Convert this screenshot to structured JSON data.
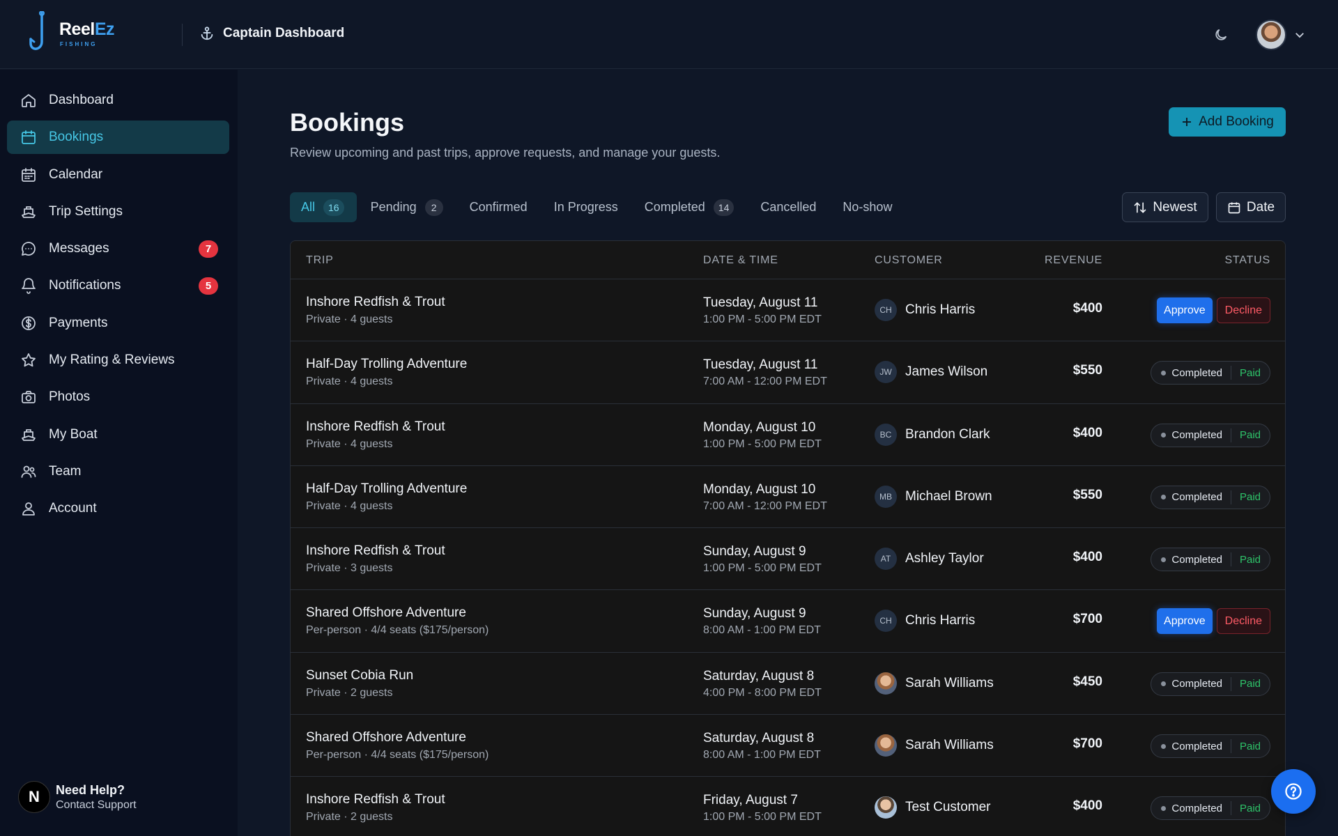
{
  "app": {
    "logo_main": "Reel",
    "logo_accent": "Ez",
    "logo_sub": "FISHING",
    "header_title": "Captain Dashboard"
  },
  "sidebar": {
    "items": [
      {
        "label": "Dashboard",
        "icon": "home-icon"
      },
      {
        "label": "Bookings",
        "icon": "calendar-icon",
        "active": true
      },
      {
        "label": "Calendar",
        "icon": "calendar-grid-icon"
      },
      {
        "label": "Trip Settings",
        "icon": "boat-icon"
      },
      {
        "label": "Messages",
        "icon": "chat-icon",
        "badge": "7"
      },
      {
        "label": "Notifications",
        "icon": "bell-icon",
        "badge": "5"
      },
      {
        "label": "Payments",
        "icon": "dollar-icon"
      },
      {
        "label": "My Rating & Reviews",
        "icon": "star-icon"
      },
      {
        "label": "Photos",
        "icon": "camera-icon"
      },
      {
        "label": "My Boat",
        "icon": "boat-icon"
      },
      {
        "label": "Team",
        "icon": "team-icon"
      },
      {
        "label": "Account",
        "icon": "user-icon"
      }
    ],
    "help_title": "Need Help?",
    "help_sub": "Contact Support",
    "help_avatar": "N"
  },
  "main": {
    "title": "Bookings",
    "subtitle": "Review upcoming and past trips, approve requests, and manage your guests.",
    "add_label": "Add Booking",
    "tabs": [
      {
        "label": "All",
        "count": "16",
        "active": true
      },
      {
        "label": "Pending",
        "count": "2"
      },
      {
        "label": "Confirmed"
      },
      {
        "label": "In Progress"
      },
      {
        "label": "Completed",
        "count": "14"
      },
      {
        "label": "Cancelled"
      },
      {
        "label": "No-show"
      }
    ],
    "sort_label": "Newest",
    "date_label": "Date"
  },
  "table": {
    "headers": {
      "trip": "TRIP",
      "datetime": "DATE & TIME",
      "customer": "CUSTOMER",
      "revenue": "REVENUE",
      "status": "STATUS"
    },
    "approve_label": "Approve",
    "decline_label": "Decline",
    "rows": [
      {
        "trip": "Inshore Redfish & Trout",
        "sub": "Private · 4 guests",
        "date": "Tuesday, August 11",
        "time": "1:00 PM - 5:00 PM EDT",
        "initials": "CH",
        "customer": "Chris Harris",
        "revenue": "$400",
        "status": "pending"
      },
      {
        "trip": "Half-Day Trolling Adventure",
        "sub": "Private · 4 guests",
        "date": "Tuesday, August 11",
        "time": "7:00 AM - 12:00 PM EDT",
        "initials": "JW",
        "customer": "James Wilson",
        "revenue": "$550",
        "status": "Completed",
        "payment": "Paid"
      },
      {
        "trip": "Inshore Redfish & Trout",
        "sub": "Private · 4 guests",
        "date": "Monday, August 10",
        "time": "1:00 PM - 5:00 PM EDT",
        "initials": "BC",
        "customer": "Brandon Clark",
        "revenue": "$400",
        "status": "Completed",
        "payment": "Paid"
      },
      {
        "trip": "Half-Day Trolling Adventure",
        "sub": "Private · 4 guests",
        "date": "Monday, August 10",
        "time": "7:00 AM - 12:00 PM EDT",
        "initials": "MB",
        "customer": "Michael Brown",
        "revenue": "$550",
        "status": "Completed",
        "payment": "Paid"
      },
      {
        "trip": "Inshore Redfish & Trout",
        "sub": "Private · 3 guests",
        "date": "Sunday, August 9",
        "time": "1:00 PM - 5:00 PM EDT",
        "initials": "AT",
        "customer": "Ashley Taylor",
        "revenue": "$400",
        "status": "Completed",
        "payment": "Paid"
      },
      {
        "trip": "Shared Offshore Adventure",
        "sub": "Per-person · 4/4 seats ($175/person)",
        "date": "Sunday, August 9",
        "time": "8:00 AM - 1:00 PM EDT",
        "initials": "CH",
        "customer": "Chris Harris",
        "revenue": "$700",
        "status": "pending"
      },
      {
        "trip": "Sunset Cobia Run",
        "sub": "Private · 2 guests",
        "date": "Saturday, August 8",
        "time": "4:00 PM - 8:00 PM EDT",
        "initials": "",
        "photo": "photo",
        "customer": "Sarah Williams",
        "revenue": "$450",
        "status": "Completed",
        "payment": "Paid"
      },
      {
        "trip": "Shared Offshore Adventure",
        "sub": "Per-person · 4/4 seats ($175/person)",
        "date": "Saturday, August 8",
        "time": "8:00 AM - 1:00 PM EDT",
        "initials": "",
        "photo": "photo",
        "customer": "Sarah Williams",
        "revenue": "$700",
        "status": "Completed",
        "payment": "Paid"
      },
      {
        "trip": "Inshore Redfish & Trout",
        "sub": "Private · 2 guests",
        "date": "Friday, August 7",
        "time": "1:00 PM - 5:00 PM EDT",
        "initials": "",
        "photo": "photo2",
        "customer": "Test Customer",
        "revenue": "$400",
        "status": "Completed",
        "payment": "Paid"
      }
    ]
  }
}
